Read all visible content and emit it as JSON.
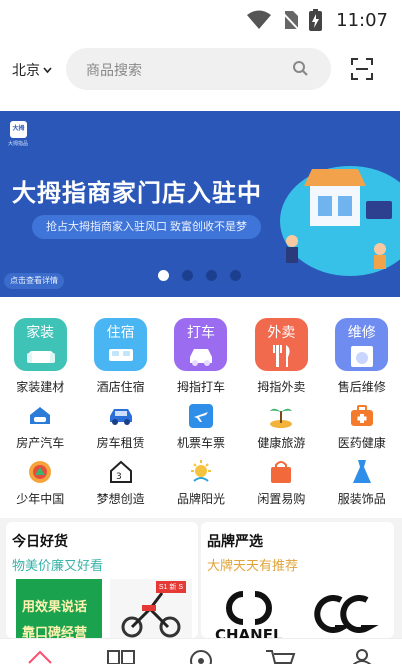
{
  "status_bar": {
    "time": "11:07"
  },
  "header": {
    "city": "北京",
    "search_placeholder": "商品搜索"
  },
  "banner": {
    "logo_text": "大拇指",
    "logo_sub": "大拇指品",
    "title": "大拇指商家门店入驻中",
    "subtitle": "抢占大拇指商家入驻风口 致富创收不是梦",
    "cta": "点击查看详情",
    "slides": 4,
    "active_slide": 1
  },
  "main_icons": [
    {
      "icon_label": "家装",
      "label": "家装建材",
      "color": "#3fc3b6"
    },
    {
      "icon_label": "住宿",
      "label": "酒店住宿",
      "color": "#49b5f2"
    },
    {
      "icon_label": "打车",
      "label": "拇指打车",
      "color": "#9b6cf0"
    },
    {
      "icon_label": "外卖",
      "label": "拇指外卖",
      "color": "#f26a4e"
    },
    {
      "icon_label": "维修",
      "label": "售后维修",
      "color": "#6f8cf0"
    }
  ],
  "row2": [
    {
      "label": "房产汽车",
      "icon": "house-car-icon"
    },
    {
      "label": "房车租赁",
      "icon": "car-icon"
    },
    {
      "label": "机票车票",
      "icon": "airplane-icon"
    },
    {
      "label": "健康旅游",
      "icon": "island-icon"
    },
    {
      "label": "医药健康",
      "icon": "medical-kit-icon"
    }
  ],
  "row3": [
    {
      "label": "少年中国",
      "icon": "youth-icon"
    },
    {
      "label": "梦想创造",
      "icon": "dream-house-icon"
    },
    {
      "label": "品牌阳光",
      "icon": "sun-icon"
    },
    {
      "label": "闲置易购",
      "icon": "shopping-bag-icon"
    },
    {
      "label": "服装饰品",
      "icon": "dress-icon"
    }
  ],
  "cards": {
    "left": {
      "title": "今日好货",
      "subtitle": "物美价廉又好看",
      "product1_line1": "用效果说话",
      "product1_line2": "靠口碑经营",
      "product2_tag": "S1 新 S",
      "colors": {
        "subtitle": "#36b3a8"
      }
    },
    "right": {
      "title": "品牌严选",
      "subtitle": "大牌天天有推荐",
      "brand1": "CHANEL",
      "brand2": "GG",
      "colors": {
        "subtitle": "#e0a43a"
      }
    }
  },
  "tabbar": [
    "home-icon",
    "category-icon",
    "discover-icon",
    "cart-icon",
    "profile-icon"
  ],
  "colors": {
    "banner_bg": "#2b58b8",
    "accent": "#ff4d6d"
  }
}
